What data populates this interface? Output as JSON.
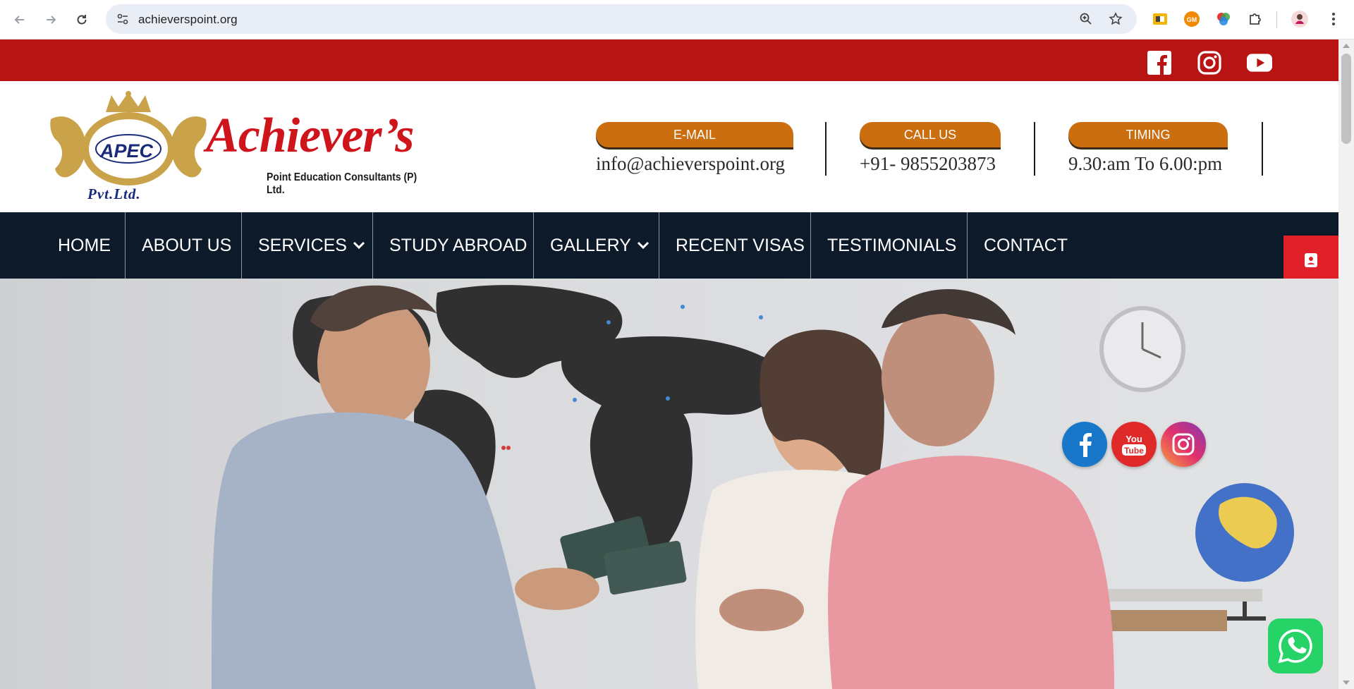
{
  "browser": {
    "url": "achieverspoint.org",
    "extensions": [
      "slides-extension-icon",
      "gm-extension-icon",
      "color-picker-extension-icon",
      "puzzle-extensions-icon",
      "profile-avatar"
    ],
    "gm_badge": "GM"
  },
  "topbar": {
    "background": "#b81414",
    "social": [
      "facebook",
      "instagram",
      "youtube"
    ]
  },
  "logo": {
    "emblem_text": "APEC",
    "emblem_suffix": "Pvt.Ltd.",
    "brand": "Achiever’s",
    "tagline": "Point Education Consultants (P) Ltd."
  },
  "contact": {
    "email": {
      "label": "E-MAIL",
      "value": "info@achieverspoint.org"
    },
    "phone": {
      "label": "CALL US",
      "value": "+91- 9855203873"
    },
    "timing": {
      "label": "TIMING",
      "value": "9.30:am To 6.00:pm"
    },
    "pill_color": "#cb6e10"
  },
  "nav": {
    "items": [
      {
        "label": "HOME",
        "dropdown": false
      },
      {
        "label": "ABOUT US",
        "dropdown": false
      },
      {
        "label": "SERVICES",
        "dropdown": true
      },
      {
        "label": "STUDY ABROAD",
        "dropdown": false
      },
      {
        "label": "GALLERY",
        "dropdown": true
      },
      {
        "label": "RECENT VISAS",
        "dropdown": false
      },
      {
        "label": "TESTIMONIALS",
        "dropdown": false
      },
      {
        "label": "CONTACT",
        "dropdown": false
      }
    ],
    "background": "#0c1a2a"
  },
  "floating_social": [
    {
      "name": "facebook",
      "color": "#1877c8"
    },
    {
      "name": "youtube",
      "label": "You Tube",
      "color": "#e02a2a"
    },
    {
      "name": "instagram",
      "color": "#c13584"
    }
  ],
  "whatsapp": {
    "color": "#25d366"
  }
}
